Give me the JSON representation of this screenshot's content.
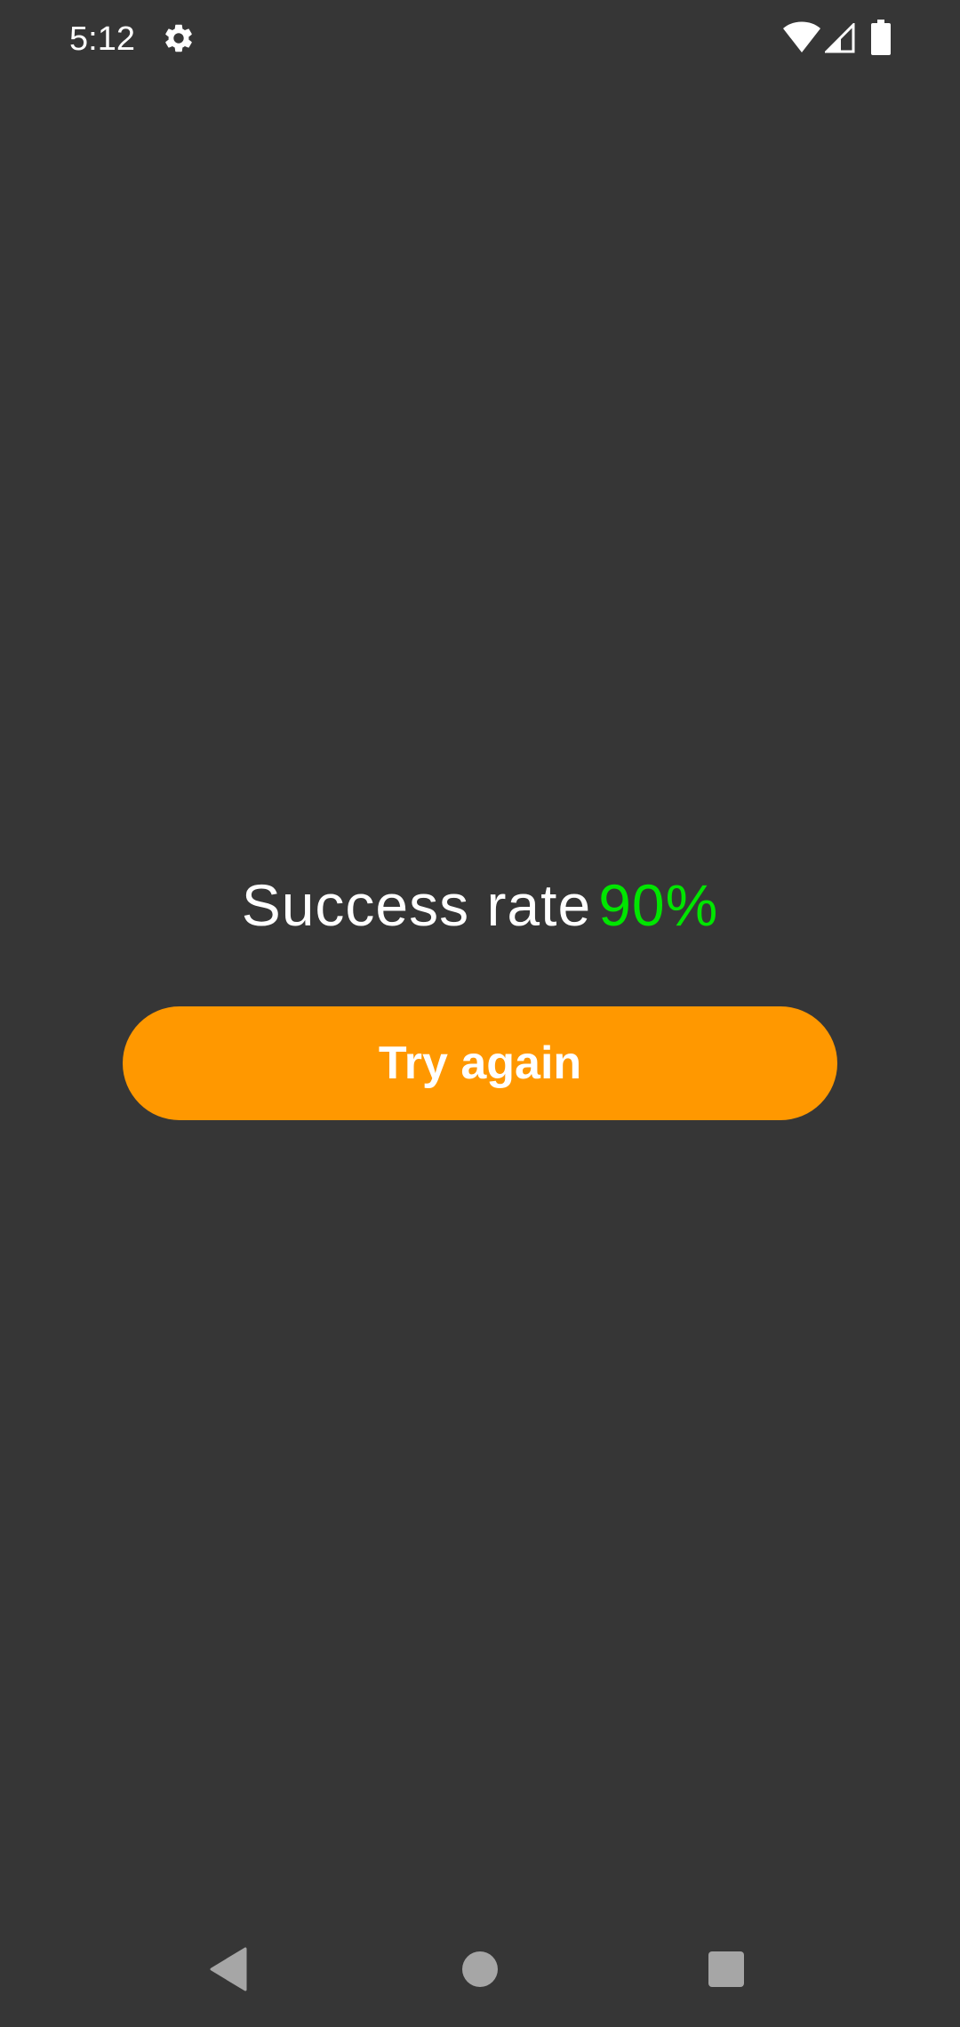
{
  "status_bar": {
    "time": "5:12",
    "icons": [
      "gear-icon",
      "wifi-icon",
      "signal-icon",
      "battery-icon"
    ]
  },
  "result": {
    "label": "Success rate",
    "value": "90%"
  },
  "actions": {
    "try_again_label": "Try again"
  },
  "navigation": {
    "icons": [
      "back-icon",
      "home-icon",
      "recents-icon"
    ]
  },
  "colors": {
    "background": "#363636",
    "accent": "#ff9800",
    "success": "#00e600",
    "text": "#ffffff",
    "nav_icon": "#a6a6a6"
  }
}
